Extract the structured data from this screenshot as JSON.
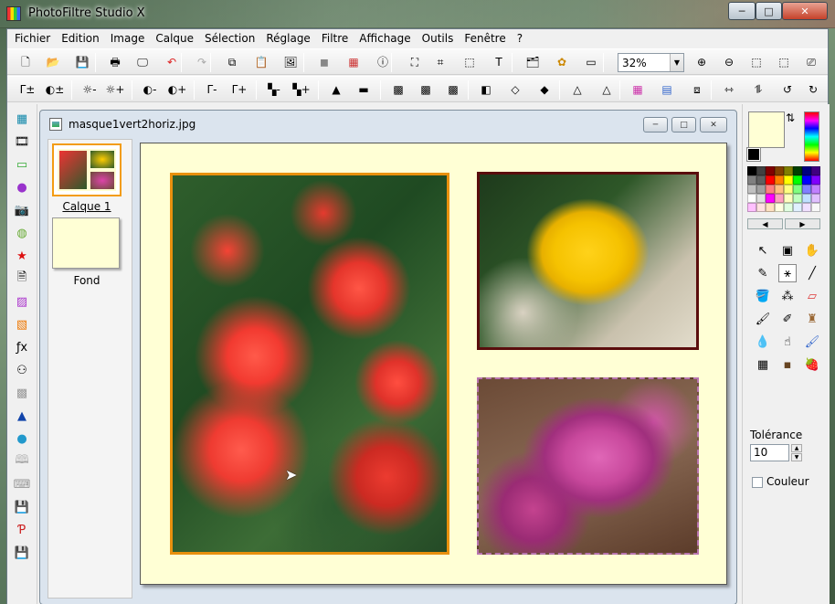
{
  "app": {
    "title": "PhotoFiltre Studio X",
    "close_glyph": "✕",
    "min_glyph": "─",
    "max_glyph": "□"
  },
  "menu": [
    "Fichier",
    "Edition",
    "Image",
    "Calque",
    "Sélection",
    "Réglage",
    "Filtre",
    "Affichage",
    "Outils",
    "Fenêtre",
    "?"
  ],
  "toolbar1": {
    "icons": [
      {
        "name": "new-file-icon",
        "glyph": "🗋"
      },
      {
        "name": "open-folder-icon",
        "glyph": "📂"
      },
      {
        "name": "save-icon",
        "glyph": "💾"
      },
      {
        "name": "print-icon",
        "glyph": "🖶"
      },
      {
        "name": "scanner-icon",
        "glyph": "🖵"
      },
      {
        "name": "undo-icon",
        "glyph": "↶",
        "color": "#d22"
      },
      {
        "name": "redo-icon",
        "glyph": "↷",
        "color": "#aaa"
      },
      {
        "name": "copy-icon",
        "glyph": "⧉"
      },
      {
        "name": "paste-icon",
        "glyph": "📋"
      },
      {
        "name": "paste-as-image-icon",
        "glyph": "🖼"
      },
      {
        "name": "grayscale-icon",
        "glyph": "◼",
        "color": "#888"
      },
      {
        "name": "color-palette-icon",
        "glyph": "▦",
        "color": "#c33"
      },
      {
        "name": "image-info-icon",
        "glyph": "ⓘ"
      },
      {
        "name": "zoom-select-icon",
        "glyph": "⛶"
      },
      {
        "name": "crop-icon",
        "glyph": "⌗"
      },
      {
        "name": "selection-icon",
        "glyph": "⬚"
      },
      {
        "name": "text-icon",
        "glyph": "T"
      },
      {
        "name": "explorer-icon",
        "glyph": "🗂"
      },
      {
        "name": "plugins-icon",
        "glyph": "✿",
        "color": "#c80"
      },
      {
        "name": "preview-icon",
        "glyph": "▭"
      }
    ],
    "zoom_value": "32%",
    "zoom_arrow": "▼",
    "zoom_icons": [
      {
        "name": "zoom-in-icon",
        "glyph": "⊕"
      },
      {
        "name": "zoom-out-icon",
        "glyph": "⊖"
      },
      {
        "name": "actual-size-icon",
        "glyph": "⬚"
      },
      {
        "name": "fit-window-icon",
        "glyph": "⬚"
      },
      {
        "name": "fullscreen-icon",
        "glyph": "⎚"
      }
    ]
  },
  "toolbar2": {
    "icons": [
      {
        "name": "levels-auto-icon",
        "glyph": "Γ±"
      },
      {
        "name": "contrast-auto-icon",
        "glyph": "◐±"
      },
      {
        "name": "brightness-minus-icon",
        "glyph": "☼-"
      },
      {
        "name": "brightness-plus-icon",
        "glyph": "☼+"
      },
      {
        "name": "contrast-minus-icon",
        "glyph": "◐-"
      },
      {
        "name": "contrast-plus-icon",
        "glyph": "◐+"
      },
      {
        "name": "gamma-minus-icon",
        "glyph": "Γ-"
      },
      {
        "name": "gamma-plus-icon",
        "glyph": "Γ+"
      },
      {
        "name": "saturation-minus-icon",
        "glyph": "▚-"
      },
      {
        "name": "saturation-plus-icon",
        "glyph": "▚+"
      },
      {
        "name": "histogram-icon",
        "glyph": "▲"
      },
      {
        "name": "color-balance-icon",
        "glyph": "▬"
      },
      {
        "name": "filter-grid-icon",
        "glyph": "▩"
      },
      {
        "name": "filter-mosaic-icon",
        "glyph": "▩"
      },
      {
        "name": "filter-texture-icon",
        "glyph": "▩"
      },
      {
        "name": "filter-emboss-icon",
        "glyph": "◧"
      },
      {
        "name": "blur-icon",
        "glyph": "◇"
      },
      {
        "name": "sharpen-icon",
        "glyph": "◆"
      },
      {
        "name": "triangle-filter-icon",
        "glyph": "△"
      },
      {
        "name": "triangle-outline-icon",
        "glyph": "△"
      },
      {
        "name": "gradient-icon",
        "glyph": "▦",
        "color": "#c3a"
      },
      {
        "name": "gradient-blue-icon",
        "glyph": "▤",
        "color": "#36c"
      },
      {
        "name": "transparency-icon",
        "glyph": "⧈"
      },
      {
        "name": "flip-horizontal-icon",
        "glyph": "⇿"
      },
      {
        "name": "flip-vertical-icon",
        "glyph": "⥮"
      },
      {
        "name": "rotate-left-icon",
        "glyph": "↺"
      },
      {
        "name": "rotate-right-icon",
        "glyph": "↻"
      }
    ]
  },
  "left_tools": [
    {
      "name": "calculator-icon",
      "glyph": "▦",
      "color": "#18a"
    },
    {
      "name": "film-icon",
      "glyph": "🎞"
    },
    {
      "name": "picture-frame-icon",
      "glyph": "▭",
      "color": "#3a3"
    },
    {
      "name": "sphere-purple-icon",
      "glyph": "●",
      "color": "#93c"
    },
    {
      "name": "camera-icon",
      "glyph": "📷"
    },
    {
      "name": "globe-icon",
      "glyph": "◍",
      "color": "#6a3"
    },
    {
      "name": "star-icon",
      "glyph": "★",
      "color": "#d11"
    },
    {
      "name": "page-icon",
      "glyph": "🗎"
    },
    {
      "name": "gradient-purple-icon",
      "glyph": "▨",
      "color": "#a3c"
    },
    {
      "name": "gradient-orange-icon",
      "glyph": "▧",
      "color": "#e70"
    },
    {
      "name": "formula-icon",
      "glyph": "ƒx"
    },
    {
      "name": "circles-icon",
      "glyph": "⚇"
    },
    {
      "name": "checker-icon",
      "glyph": "▩",
      "color": "#999"
    },
    {
      "name": "histogram-blue-icon",
      "glyph": "▲",
      "color": "#14a"
    },
    {
      "name": "blue-ball-icon",
      "glyph": "●",
      "color": "#29c"
    },
    {
      "name": "book-icon",
      "glyph": "🕮",
      "color": "#aaa"
    },
    {
      "name": "keyboard-icon",
      "glyph": "⌨",
      "color": "#999"
    },
    {
      "name": "save-2000-icon",
      "glyph": "💾"
    },
    {
      "name": "pdf-icon",
      "glyph": "Ƥ",
      "color": "#c22"
    },
    {
      "name": "save-html-icon",
      "glyph": "💾"
    }
  ],
  "document": {
    "title": "masque1vert2horiz.jpg",
    "min_glyph": "─",
    "max_glyph": "□",
    "close_glyph": "✕",
    "layers": [
      {
        "label": "Calque 1"
      },
      {
        "label": "Fond"
      }
    ],
    "cursor_glyph": "➤"
  },
  "right_panel": {
    "swap_glyph": "⇅",
    "palette_prev": "◀",
    "palette_next": "▶",
    "palette_colors": [
      "#000000",
      "#404040",
      "#800000",
      "#804000",
      "#808000",
      "#004000",
      "#000080",
      "#400080",
      "#808080",
      "#606060",
      "#ff0000",
      "#ff8000",
      "#ffff00",
      "#00ff00",
      "#0000ff",
      "#8000ff",
      "#c0c0c0",
      "#a0a0a0",
      "#ff8080",
      "#ffc080",
      "#ffff80",
      "#80ff80",
      "#8080ff",
      "#c080ff",
      "#ffffff",
      "#e0e0e0",
      "#ff00ff",
      "#ffa0c0",
      "#ffffc0",
      "#c0ffc0",
      "#c0e0ff",
      "#e0c0ff",
      "#ffc0ff",
      "#ffe0e0",
      "#ffe0c0",
      "#ffffe0",
      "#e0ffe0",
      "#e0f0ff",
      "#f0e0ff",
      "#f8f8f8"
    ],
    "tools": [
      {
        "name": "pointer-icon",
        "glyph": "↖"
      },
      {
        "name": "selection-tool-icon",
        "glyph": "▣"
      },
      {
        "name": "hand-icon",
        "glyph": "✋"
      },
      {
        "name": "eyedropper-icon",
        "glyph": "✎"
      },
      {
        "name": "magic-wand-icon",
        "glyph": "⚹"
      },
      {
        "name": "line-icon",
        "glyph": "╱"
      },
      {
        "name": "paint-bucket-icon",
        "glyph": "🪣"
      },
      {
        "name": "spray-icon",
        "glyph": "⁂"
      },
      {
        "name": "eraser-icon",
        "glyph": "▱",
        "color": "#d33"
      },
      {
        "name": "brush-icon",
        "glyph": "🖌"
      },
      {
        "name": "advanced-brush-icon",
        "glyph": "✐"
      },
      {
        "name": "stamp-icon",
        "glyph": "♜",
        "color": "#963"
      },
      {
        "name": "drop-icon",
        "glyph": "💧"
      },
      {
        "name": "finger-smudge-icon",
        "glyph": "☝"
      },
      {
        "name": "retouch-brush-icon",
        "glyph": "🖌",
        "color": "#36c"
      },
      {
        "name": "clone-icon",
        "glyph": "▦"
      },
      {
        "name": "portrait-icon",
        "glyph": "▪",
        "color": "#642"
      },
      {
        "name": "strawberry-icon",
        "glyph": "🍓"
      }
    ],
    "tolerance_label": "Tolérance",
    "tolerance_value": "10",
    "spin_up": "▲",
    "spin_down": "▼",
    "couleur_label": "Couleur"
  }
}
